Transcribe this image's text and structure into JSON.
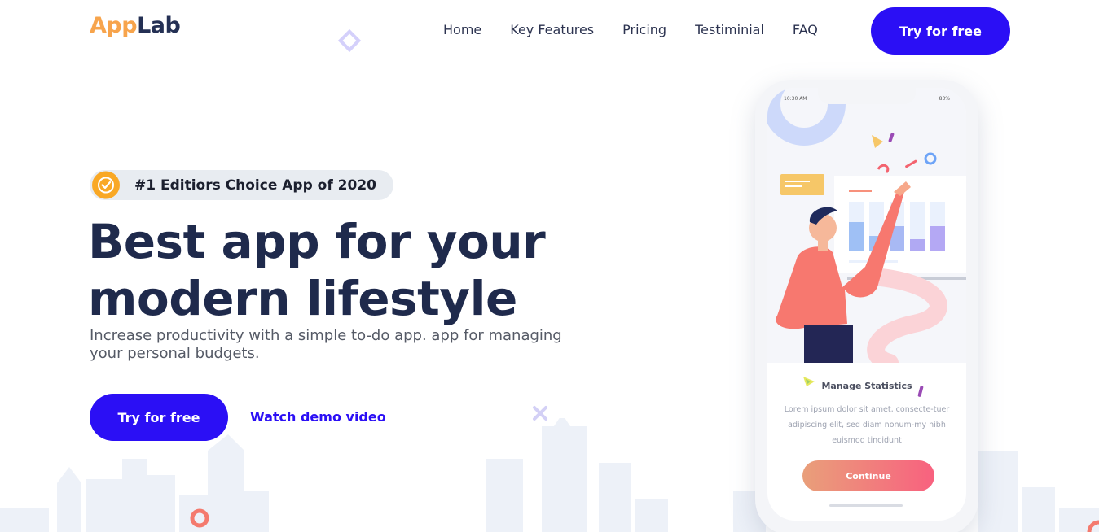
{
  "header": {
    "logo_part1": "App",
    "logo_part2": "Lab",
    "nav": [
      "Home",
      "Key Features",
      "Pricing",
      "Testiminial",
      "FAQ"
    ],
    "cta": "Try for free"
  },
  "hero": {
    "badge": "#1 Editiors Choice App of 2020",
    "title": "Best app for your modern lifestyle",
    "subtitle": "Increase productivity with a simple to-do app. app for managing your personal budgets.",
    "cta": "Try for free",
    "demo": "Watch demo video"
  },
  "phone": {
    "status_time": "10:30 AM",
    "status_battery": "83%",
    "card_title": "Manage Statistics",
    "card_text": "Lorem ipsum dolor sit amet, consecte-tuer adipiscing elit, sed diam nonum-my nibh euismod tincidunt",
    "card_button": "Continue"
  },
  "colors": {
    "primary": "#2b0ff5",
    "logo_orange": "#f7a44c",
    "logo_navy": "#243054",
    "badge_bg": "#e8ecf1",
    "badge_icon": "#f9a825"
  },
  "icons": [
    "verified-badge-icon",
    "diamond-decoration-icon",
    "x-decoration-icon",
    "ring-decoration-icon"
  ]
}
